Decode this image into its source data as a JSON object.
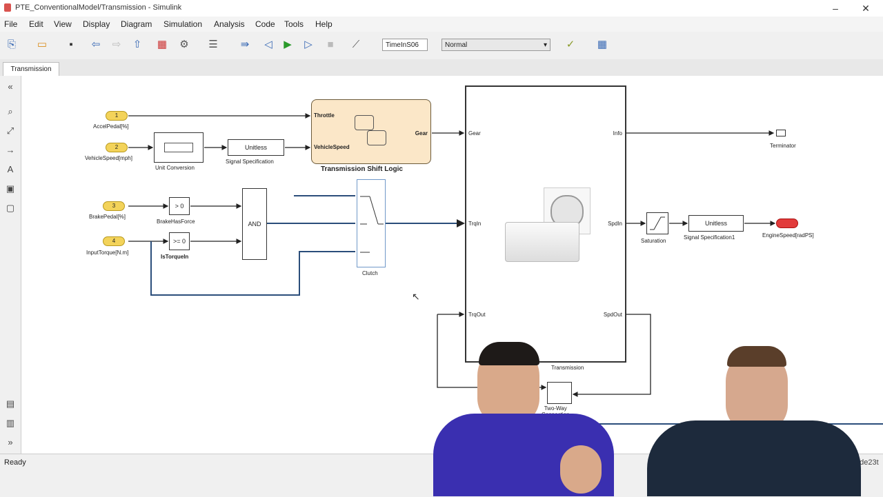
{
  "window": {
    "title": "PTE_ConventionalModel/Transmission - Simulink",
    "min": "–",
    "close": "✕"
  },
  "menu": [
    "File",
    "Edit",
    "View",
    "Display",
    "Diagram",
    "Simulation",
    "Analysis",
    "Code",
    "Tools",
    "Help"
  ],
  "toolbar": {
    "stop_time": "TimeInS06",
    "sim_mode": "Normal"
  },
  "tab": "Transmission",
  "status": {
    "left": "Ready",
    "right": "ode23t"
  },
  "blocks": {
    "in1": "1",
    "in1_label": "AccelPedal[%]",
    "in2": "2",
    "in2_label": "VehicleSpeed[mph]",
    "in3": "3",
    "in3_label": "BrakePedal[%]",
    "in4": "4",
    "in4_label": "InputTorque[N.m]",
    "unit_conv": "Unit Conversion",
    "sigspec": "Unitless",
    "sigspec_label": "Signal Specification",
    "shift_throttle": "Throttle",
    "shift_vspeed": "VehicleSpeed",
    "shift_gear": "Gear",
    "shift_label": "Transmission Shift Logic",
    "cmp1": "> 0",
    "cmp1_label": "BrakeHasForce",
    "cmp2": ">= 0",
    "cmp2_label": "IsTorqueIn",
    "and": "AND",
    "clutch_label": "Clutch",
    "trans_gear": "Gear",
    "trans_info": "Info",
    "trans_trqin": "TrqIn",
    "trans_spdin": "SpdIn",
    "trans_trqout": "TrqOut",
    "trans_spdout": "SpdOut",
    "trans_label": "Transmission",
    "terminator_label": "Terminator",
    "sat_label": "Saturation",
    "sigspec2": "Unitless",
    "sigspec2_label": "Signal Specification1",
    "out_label": "EngineSpeed[radPS]",
    "twoway": "Two-Way\nConnection"
  }
}
